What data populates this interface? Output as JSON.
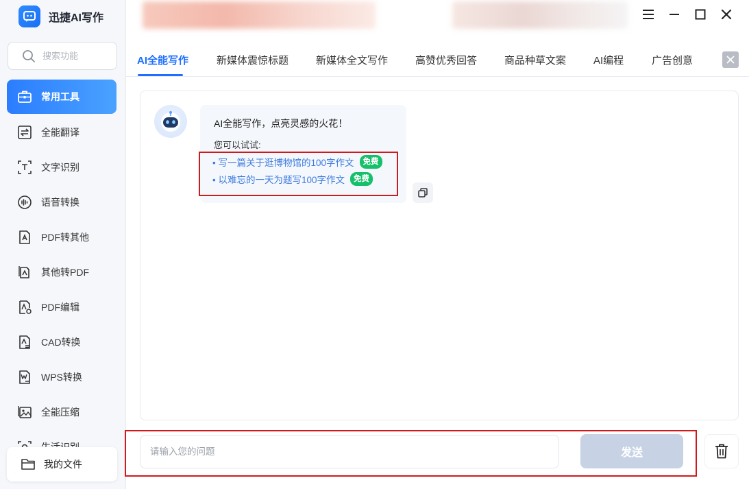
{
  "app": {
    "title": "迅捷AI写作"
  },
  "search": {
    "placeholder": "搜索功能"
  },
  "sidebar": {
    "items": [
      {
        "label": "常用工具",
        "icon": "toolbox-icon",
        "active": true
      },
      {
        "label": "全能翻译",
        "icon": "translate-icon"
      },
      {
        "label": "文字识别",
        "icon": "text-recognition-icon"
      },
      {
        "label": "语音转换",
        "icon": "voice-icon"
      },
      {
        "label": "PDF转其他",
        "icon": "pdf-convert-icon"
      },
      {
        "label": "其他转PDF",
        "icon": "to-pdf-icon"
      },
      {
        "label": "PDF编辑",
        "icon": "pdf-edit-icon"
      },
      {
        "label": "CAD转换",
        "icon": "cad-icon"
      },
      {
        "label": "WPS转换",
        "icon": "wps-icon"
      },
      {
        "label": "全能压缩",
        "icon": "compress-icon"
      },
      {
        "label": "生活识别",
        "icon": "camera-icon"
      }
    ],
    "my_files": "我的文件"
  },
  "tabs": [
    {
      "label": "AI全能写作",
      "active": true
    },
    {
      "label": "新媒体震惊标题"
    },
    {
      "label": "新媒体全文写作"
    },
    {
      "label": "高赞优秀回答"
    },
    {
      "label": "商品种草文案"
    },
    {
      "label": "AI编程"
    },
    {
      "label": "广告创意"
    }
  ],
  "chat": {
    "greeting": "AI全能写作，点亮灵感的火花！",
    "try_label": "您可以试试:",
    "suggestions": [
      {
        "text": "写一篇关于逛博物馆的100字作文",
        "badge": "免费"
      },
      {
        "text": "以难忘的一天为题写100字作文",
        "badge": "免费"
      }
    ]
  },
  "input": {
    "placeholder": "请输入您的问题",
    "value": ""
  },
  "send_label": "发送",
  "colors": {
    "accent": "#1e6fff",
    "free_badge": "#16c06b",
    "highlight": "#d0191c",
    "send_disabled": "#c7d3e4"
  }
}
